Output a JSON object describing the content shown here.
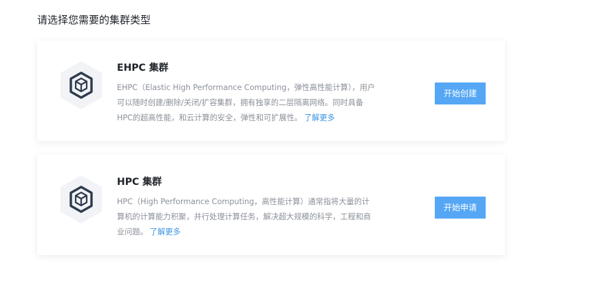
{
  "page": {
    "title": "请选择您需要的集群类型"
  },
  "cards": [
    {
      "title": "EHPC 集群",
      "desc_lines": [
        "EHPC（Elastic High Performance Computing，弹性高性能计算），用户",
        "可以随时创建/删除/关闭/扩容集群，拥有独享的二层隔离网络。同时具备",
        "HPC的超高性能，和云计算的安全，弹性和可扩展性。"
      ],
      "learn_more": "了解更多",
      "action_label": "开始创建",
      "icon": "cube-hexagon-icon"
    },
    {
      "title": "HPC 集群",
      "desc_lines": [
        "HPC（High Performance Computing，高性能计算）通常指将大量的计",
        "算机的计算能力积聚，并行处理计算任务，解决超大规模的科学，工程和商",
        "业问题。"
      ],
      "learn_more": "了解更多",
      "action_label": "开始申请",
      "icon": "cube-hexagon-icon"
    }
  ],
  "colors": {
    "accent": "#55a7f5",
    "link": "#3a95e6",
    "icon_bg": "#f1f3f6",
    "icon_fg": "#2e3a4d"
  }
}
